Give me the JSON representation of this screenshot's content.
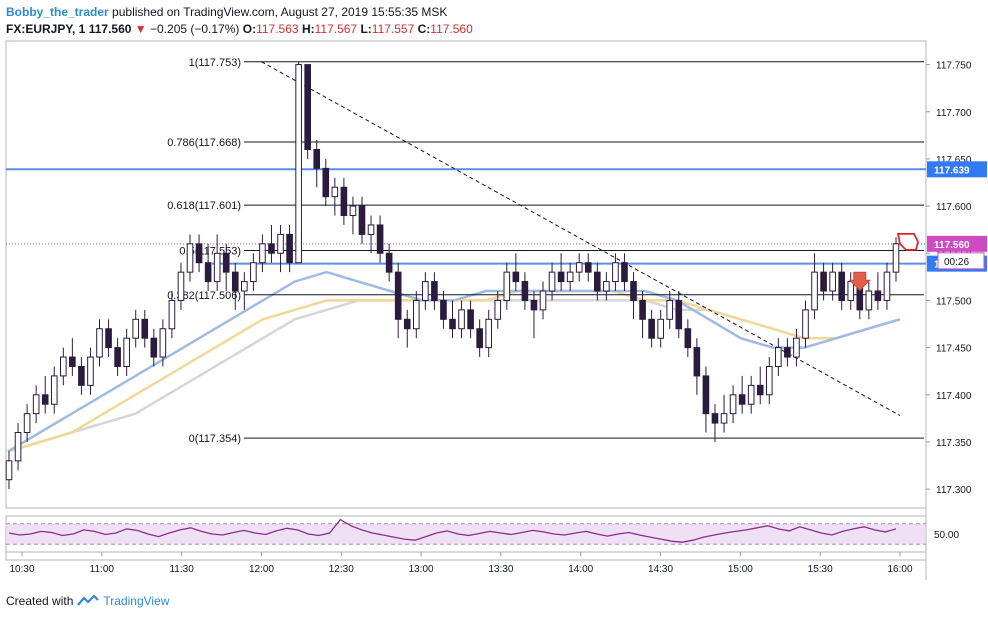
{
  "header": {
    "user": "Bobby_the_trader",
    "published": "published on TradingView.com, August 27, 2019 15:55:35 MSK",
    "symbol": "FX:EURJPY, 1",
    "last": "117.560",
    "change": "−0.205 (−0.17%)",
    "o_label": "O:",
    "o_val": "117.563",
    "h_label": "H:",
    "h_val": "117.567",
    "l_label": "L:",
    "l_val": "117.557",
    "c_label": "C:",
    "c_val": "117.560"
  },
  "footer": {
    "created": "Created with",
    "brand": "TradingView"
  },
  "colors": {
    "candle_up": "#ffffff",
    "candle_down": "#2b1b3e",
    "wick": "#2b1b3e",
    "fib": "#131722",
    "hline": "#5b8ee6",
    "ma_fast": "#9fbbe3",
    "ma_mid": "#f2d898",
    "ma_slow": "#d6d6d6",
    "rsi": "#8a2c8e",
    "rsi_band": "#f0e0f6",
    "last_price": "#3179f5",
    "arrow": "#e0604d"
  },
  "chart_data": {
    "type": "candlestick",
    "symbol": "FX:EURJPY",
    "interval": "1",
    "x_ticks": [
      "10:30",
      "11:00",
      "11:30",
      "12:00",
      "12:30",
      "13:00",
      "13:30",
      "14:00",
      "14:30",
      "15:00",
      "15:30",
      "16:00"
    ],
    "y_ticks": [
      "117.300",
      "117.350",
      "117.400",
      "117.450",
      "117.500",
      "117.550",
      "117.600",
      "117.650",
      "117.700",
      "117.750"
    ],
    "ylim": [
      117.28,
      117.775
    ],
    "fib_levels": [
      {
        "label": "1(117.753)",
        "value": 117.753
      },
      {
        "label": "0.786(117.668)",
        "value": 117.668
      },
      {
        "label": "0.618(117.601)",
        "value": 117.601
      },
      {
        "label": "0.5(117.553)",
        "value": 117.553
      },
      {
        "label": "0.382(117.506)",
        "value": 117.506
      },
      {
        "label": "0(117.354)",
        "value": 117.354
      }
    ],
    "horizontal_lines": [
      {
        "label": "117.639",
        "value": 117.639
      },
      {
        "label": "117.539",
        "value": 117.539
      }
    ],
    "last_price": {
      "label": "117.560",
      "value": 117.56,
      "countdown": "00:26"
    },
    "trendline": {
      "from": {
        "time": "12:00",
        "price": 117.753
      },
      "to": {
        "time": "16:00",
        "price": 117.378
      }
    },
    "candles": [
      [
        117.31,
        117.33,
        117.3,
        117.34
      ],
      [
        117.33,
        117.36,
        117.32,
        117.37
      ],
      [
        117.36,
        117.38,
        117.35,
        117.39
      ],
      [
        117.38,
        117.4,
        117.37,
        117.41
      ],
      [
        117.4,
        117.39,
        117.38,
        117.42
      ],
      [
        117.39,
        117.42,
        117.38,
        117.43
      ],
      [
        117.42,
        117.44,
        117.41,
        117.45
      ],
      [
        117.44,
        117.43,
        117.42,
        117.46
      ],
      [
        117.43,
        117.41,
        117.4,
        117.44
      ],
      [
        117.41,
        117.44,
        117.4,
        117.45
      ],
      [
        117.44,
        117.47,
        117.43,
        117.48
      ],
      [
        117.47,
        117.45,
        117.44,
        117.48
      ],
      [
        117.45,
        117.43,
        117.42,
        117.46
      ],
      [
        117.43,
        117.46,
        117.42,
        117.47
      ],
      [
        117.46,
        117.48,
        117.45,
        117.49
      ],
      [
        117.48,
        117.46,
        117.45,
        117.49
      ],
      [
        117.46,
        117.44,
        117.43,
        117.47
      ],
      [
        117.44,
        117.47,
        117.43,
        117.48
      ],
      [
        117.47,
        117.5,
        117.46,
        117.51
      ],
      [
        117.5,
        117.53,
        117.49,
        117.54
      ],
      [
        117.53,
        117.56,
        117.52,
        117.57
      ],
      [
        117.56,
        117.54,
        117.53,
        117.57
      ],
      [
        117.54,
        117.52,
        117.51,
        117.56
      ],
      [
        117.52,
        117.55,
        117.51,
        117.57
      ],
      [
        117.55,
        117.53,
        117.51,
        117.56
      ],
      [
        117.53,
        117.51,
        117.49,
        117.54
      ],
      [
        117.51,
        117.52,
        117.49,
        117.53
      ],
      [
        117.52,
        117.54,
        117.51,
        117.55
      ],
      [
        117.54,
        117.56,
        117.53,
        117.57
      ],
      [
        117.56,
        117.55,
        117.54,
        117.58
      ],
      [
        117.55,
        117.57,
        117.53,
        117.58
      ],
      [
        117.57,
        117.54,
        117.53,
        117.58
      ],
      [
        117.54,
        117.75,
        117.54,
        117.753
      ],
      [
        117.75,
        117.66,
        117.65,
        117.75
      ],
      [
        117.66,
        117.64,
        117.62,
        117.67
      ],
      [
        117.64,
        117.61,
        117.6,
        117.65
      ],
      [
        117.61,
        117.62,
        117.59,
        117.63
      ],
      [
        117.62,
        117.59,
        117.58,
        117.63
      ],
      [
        117.59,
        117.6,
        117.57,
        117.61
      ],
      [
        117.6,
        117.57,
        117.56,
        117.61
      ],
      [
        117.57,
        117.58,
        117.55,
        117.59
      ],
      [
        117.58,
        117.55,
        117.54,
        117.59
      ],
      [
        117.55,
        117.53,
        117.52,
        117.56
      ],
      [
        117.53,
        117.48,
        117.46,
        117.54
      ],
      [
        117.48,
        117.47,
        117.45,
        117.49
      ],
      [
        117.47,
        117.5,
        117.46,
        117.51
      ],
      [
        117.5,
        117.52,
        117.49,
        117.53
      ],
      [
        117.52,
        117.5,
        117.49,
        117.53
      ],
      [
        117.5,
        117.48,
        117.47,
        117.51
      ],
      [
        117.48,
        117.47,
        117.46,
        117.5
      ],
      [
        117.47,
        117.49,
        117.46,
        117.5
      ],
      [
        117.49,
        117.47,
        117.46,
        117.5
      ],
      [
        117.47,
        117.45,
        117.44,
        117.48
      ],
      [
        117.45,
        117.48,
        117.44,
        117.49
      ],
      [
        117.48,
        117.5,
        117.47,
        117.51
      ],
      [
        117.5,
        117.53,
        117.49,
        117.54
      ],
      [
        117.53,
        117.52,
        117.51,
        117.55
      ],
      [
        117.52,
        117.5,
        117.49,
        117.53
      ],
      [
        117.5,
        117.49,
        117.46,
        117.51
      ],
      [
        117.49,
        117.51,
        117.48,
        117.52
      ],
      [
        117.51,
        117.53,
        117.5,
        117.54
      ],
      [
        117.53,
        117.52,
        117.51,
        117.55
      ],
      [
        117.52,
        117.53,
        117.51,
        117.54
      ],
      [
        117.53,
        117.54,
        117.52,
        117.55
      ],
      [
        117.54,
        117.53,
        117.52,
        117.55
      ],
      [
        117.53,
        117.51,
        117.5,
        117.54
      ],
      [
        117.51,
        117.52,
        117.5,
        117.53
      ],
      [
        117.52,
        117.54,
        117.51,
        117.55
      ],
      [
        117.54,
        117.52,
        117.51,
        117.55
      ],
      [
        117.52,
        117.5,
        117.48,
        117.53
      ],
      [
        117.5,
        117.48,
        117.46,
        117.51
      ],
      [
        117.48,
        117.46,
        117.45,
        117.49
      ],
      [
        117.46,
        117.48,
        117.45,
        117.49
      ],
      [
        117.48,
        117.5,
        117.47,
        117.51
      ],
      [
        117.5,
        117.47,
        117.46,
        117.51
      ],
      [
        117.47,
        117.45,
        117.44,
        117.48
      ],
      [
        117.45,
        117.42,
        117.4,
        117.46
      ],
      [
        117.42,
        117.38,
        117.36,
        117.43
      ],
      [
        117.38,
        117.37,
        117.35,
        117.39
      ],
      [
        117.37,
        117.38,
        117.36,
        117.4
      ],
      [
        117.38,
        117.4,
        117.37,
        117.41
      ],
      [
        117.4,
        117.39,
        117.38,
        117.42
      ],
      [
        117.39,
        117.41,
        117.38,
        117.42
      ],
      [
        117.41,
        117.4,
        117.39,
        117.43
      ],
      [
        117.4,
        117.43,
        117.39,
        117.44
      ],
      [
        117.43,
        117.45,
        117.42,
        117.46
      ],
      [
        117.45,
        117.44,
        117.43,
        117.46
      ],
      [
        117.44,
        117.46,
        117.43,
        117.47
      ],
      [
        117.46,
        117.49,
        117.45,
        117.5
      ],
      [
        117.49,
        117.53,
        117.48,
        117.55
      ],
      [
        117.53,
        117.51,
        117.5,
        117.54
      ],
      [
        117.51,
        117.53,
        117.5,
        117.54
      ],
      [
        117.53,
        117.5,
        117.49,
        117.54
      ],
      [
        117.5,
        117.52,
        117.49,
        117.53
      ],
      [
        117.52,
        117.49,
        117.48,
        117.53
      ],
      [
        117.49,
        117.51,
        117.48,
        117.52
      ],
      [
        117.51,
        117.5,
        117.49,
        117.53
      ],
      [
        117.5,
        117.53,
        117.49,
        117.54
      ],
      [
        117.53,
        117.56,
        117.52,
        117.567
      ]
    ],
    "ema_fast": [
      117.34,
      117.36,
      117.38,
      117.4,
      117.42,
      117.44,
      117.46,
      117.48,
      117.5,
      117.52,
      117.53,
      117.52,
      117.51,
      117.5,
      117.5,
      117.51,
      117.51,
      117.51,
      117.51,
      117.51,
      117.51,
      117.5,
      117.48,
      117.46,
      117.45,
      117.45,
      117.46,
      117.47,
      117.48
    ],
    "ema_mid": [
      117.34,
      117.35,
      117.36,
      117.38,
      117.4,
      117.42,
      117.44,
      117.46,
      117.48,
      117.49,
      117.5,
      117.5,
      117.5,
      117.5,
      117.5,
      117.5,
      117.51,
      117.51,
      117.51,
      117.51,
      117.5,
      117.5,
      117.49,
      117.48,
      117.47,
      117.46,
      117.46,
      117.47,
      117.48
    ],
    "ema_slow": [
      117.34,
      117.35,
      117.36,
      117.37,
      117.38,
      117.4,
      117.42,
      117.44,
      117.46,
      117.48,
      117.49,
      117.5,
      117.5,
      117.5,
      117.5,
      117.5,
      117.5,
      117.5,
      117.5,
      117.5,
      117.5,
      117.49,
      117.49,
      117.48,
      117.47,
      117.46,
      117.46,
      117.47,
      117.48
    ],
    "rsi": {
      "label": "50.00",
      "band": [
        30,
        70
      ],
      "values": [
        52,
        48,
        50,
        55,
        53,
        47,
        50,
        58,
        55,
        49,
        52,
        60,
        57,
        50,
        45,
        52,
        58,
        62,
        55,
        50,
        48,
        53,
        57,
        52,
        49,
        56,
        61,
        58,
        50,
        47,
        52,
        78,
        66,
        58,
        52,
        48,
        44,
        40,
        38,
        45,
        52,
        56,
        50,
        47,
        51,
        55,
        52,
        49,
        53,
        57,
        54,
        50,
        48,
        52,
        55,
        50,
        46,
        50,
        53,
        48,
        44,
        40,
        36,
        34,
        38,
        44,
        48,
        52,
        55,
        58,
        62,
        66,
        60,
        56,
        64,
        58,
        52,
        48,
        55,
        60,
        64,
        58,
        54,
        60
      ]
    }
  }
}
